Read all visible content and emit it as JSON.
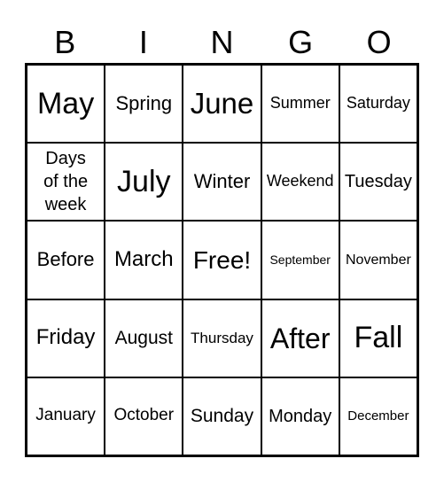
{
  "header": [
    "B",
    "I",
    "N",
    "G",
    "O"
  ],
  "cells": [
    {
      "text": "May",
      "size": 34
    },
    {
      "text": "Spring",
      "size": 22
    },
    {
      "text": "June",
      "size": 33
    },
    {
      "text": "Summer",
      "size": 18
    },
    {
      "text": "Saturday",
      "size": 18
    },
    {
      "text": "Days of the week",
      "size": 20
    },
    {
      "text": "July",
      "size": 34
    },
    {
      "text": "Winter",
      "size": 22
    },
    {
      "text": "Weekend",
      "size": 18
    },
    {
      "text": "Tuesday",
      "size": 20
    },
    {
      "text": "Before",
      "size": 22
    },
    {
      "text": "March",
      "size": 24
    },
    {
      "text": "Free!",
      "size": 28
    },
    {
      "text": "September",
      "size": 14
    },
    {
      "text": "November",
      "size": 16
    },
    {
      "text": "Friday",
      "size": 24
    },
    {
      "text": "August",
      "size": 21
    },
    {
      "text": "Thursday",
      "size": 17
    },
    {
      "text": "After",
      "size": 32
    },
    {
      "text": "Fall",
      "size": 34
    },
    {
      "text": "January",
      "size": 19
    },
    {
      "text": "October",
      "size": 19
    },
    {
      "text": "Sunday",
      "size": 21
    },
    {
      "text": "Monday",
      "size": 20
    },
    {
      "text": "December",
      "size": 15
    }
  ]
}
